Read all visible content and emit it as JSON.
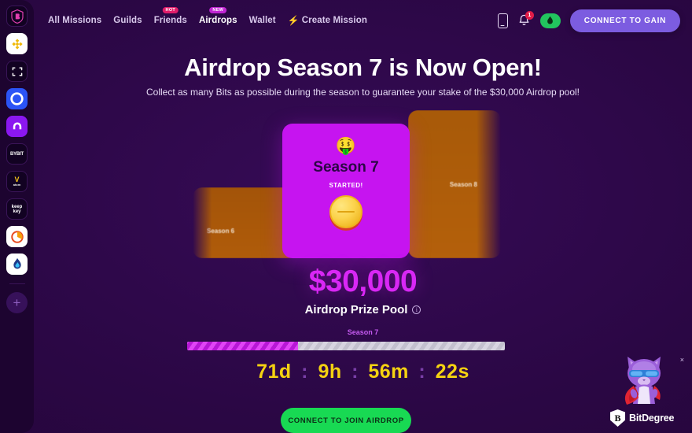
{
  "sidebar": {
    "items": [
      {
        "name": "bitdegree-logo",
        "label": "B",
        "style": "dark"
      },
      {
        "name": "binance-icon",
        "label": "",
        "style": "white"
      },
      {
        "name": "scan-frame-icon",
        "label": "",
        "style": "dark"
      },
      {
        "name": "coinbase-icon",
        "label": "",
        "style": "dark"
      },
      {
        "name": "m-wallet-icon",
        "label": "",
        "style": "dark"
      },
      {
        "name": "bybit-icon",
        "label": "BYBIT",
        "style": "dark"
      },
      {
        "name": "vatom-icon",
        "label": "atom",
        "style": "dark"
      },
      {
        "name": "keepkey-icon",
        "label": "keep key",
        "style": "dark"
      },
      {
        "name": "pie-chart-icon",
        "label": "",
        "style": "white"
      },
      {
        "name": "blue-flame-icon",
        "label": "",
        "style": "white"
      }
    ],
    "add_label": "+"
  },
  "nav": {
    "links": [
      {
        "label": "All Missions",
        "badge": null,
        "active": false
      },
      {
        "label": "Guilds",
        "badge": null,
        "active": false
      },
      {
        "label": "Friends",
        "badge": "HOT",
        "badge_type": "hot",
        "active": false
      },
      {
        "label": "Airdrops",
        "badge": "NEW",
        "badge_type": "new",
        "active": true
      },
      {
        "label": "Wallet",
        "badge": null,
        "active": false
      }
    ],
    "create_mission": "Create Mission",
    "bell_count": "1",
    "connect_button": "CONNECT TO GAIN"
  },
  "hero": {
    "title": "Airdrop Season 7 is Now Open!",
    "subtitle": "Collect as many Bits as possible during the season to guarantee your stake of the $30,000 Airdrop pool!"
  },
  "cards": {
    "previous": {
      "label": "Season 6"
    },
    "current": {
      "emoji": "🤑",
      "title": "Season 7",
      "status": "STARTED!"
    },
    "next": {
      "label": "Season 8"
    }
  },
  "prize": {
    "amount": "$30,000",
    "label": "Airdrop Prize Pool",
    "info_glyph": "i"
  },
  "progress": {
    "season_label": "Season 7",
    "percent": 35
  },
  "countdown": {
    "days": "71d",
    "hours": "9h",
    "minutes": "56m",
    "seconds": "22s",
    "separator": ":"
  },
  "cta": {
    "join_label": "CONNECT TO JOIN AIRDROP"
  },
  "bitdegree": {
    "name": "BitDegree",
    "logo_letter": "B",
    "close_glyph": "×"
  },
  "colors": {
    "background": "#2a0845",
    "sidebar": "#1d0430",
    "accent_magenta": "#c614f0",
    "prize_magenta": "#d927f5",
    "countdown_yellow": "#f5d211",
    "cta_green": "#18d953",
    "connect_purple": "#7c5ce0",
    "card_orange": "#b05c0a",
    "badge_hot": "#e11d6a",
    "badge_new": "#c026d3"
  }
}
